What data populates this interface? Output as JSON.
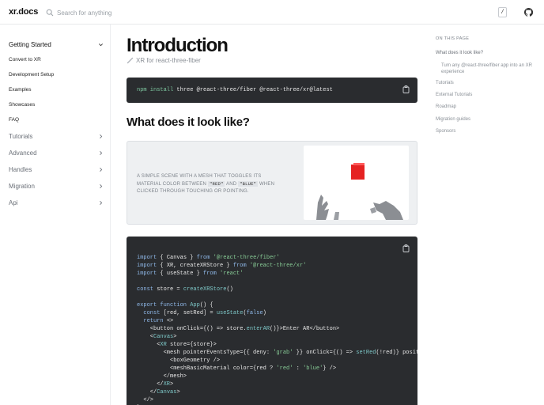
{
  "header": {
    "logo": "xr.docs",
    "search_placeholder": "Search for anything",
    "kbd": "/",
    "github_icon": "github-icon"
  },
  "sidebar": {
    "getting_started": "Getting Started",
    "items": [
      "Convert to XR",
      "Development Setup",
      "Examples",
      "Showcases",
      "FAQ"
    ],
    "sections": [
      "Tutorials",
      "Advanced",
      "Handles",
      "Migration",
      "Api"
    ]
  },
  "main": {
    "title": "Introduction",
    "subtitle": "XR for react-three-fiber",
    "subtitle_icon": "vr-icon",
    "install_cmd_kw": "npm install",
    "install_cmd_rest": " three @react-three/fiber @react-three/xr@latest",
    "h2": "What does it look like?",
    "caption_part1": "A simple scene with a mesh that toggles its material color between ",
    "caption_red": "\"red\"",
    "caption_and": " and ",
    "caption_blue": "\"blue\"",
    "caption_part2": " when clicked through touching or pointing.",
    "code_lines": [
      "import { Canvas } from '@react-three/fiber'",
      "import { XR, createXRStore } from '@react-three/xr'",
      "import { useState } from 'react'",
      "",
      "const store = createXRStore()",
      "",
      "export function App() {",
      "  const [red, setRed] = useState(false)",
      "  return <>",
      "    <button onClick={() => store.enterAR()}>Enter AR</button>",
      "    <Canvas>",
      "      <XR store={store}>",
      "        <mesh pointerEventsType={{ deny: 'grab' }} onClick={() => setRed(!red)} position",
      "          <boxGeometry />",
      "          <meshBasicMaterial color={red ? 'red' : 'blue'} />",
      "        </mesh>",
      "      </XR>",
      "    </Canvas>",
      "  </>",
      "}"
    ]
  },
  "toc": {
    "title": "On this page",
    "items": [
      "What does it look like?",
      "Turn any @react-three/fiber app into an XR experience",
      "Tutorials",
      "External Tutorials",
      "Roadmap",
      "Migration guides",
      "Sponsors"
    ]
  },
  "colors": {
    "code_bg": "#2a2c2f",
    "accent_red": "#e53935"
  }
}
